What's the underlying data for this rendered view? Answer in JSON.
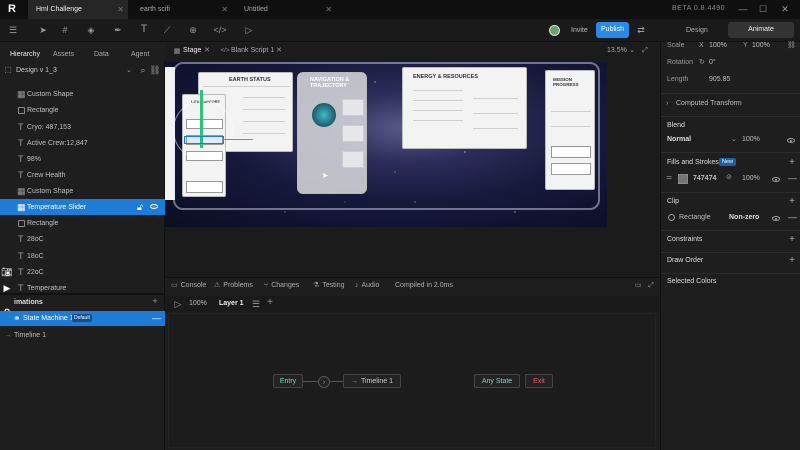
{
  "titlebar": {
    "tabs": [
      {
        "label": "Hml Challenge"
      },
      {
        "label": "earth scifi"
      },
      {
        "label": "Untitled"
      }
    ],
    "version": "BETA 0.8.4490"
  },
  "toolbar": {
    "invite": "Invite",
    "publish": "Publish",
    "design_tab": "Design",
    "animate_tab": "Animate"
  },
  "doc_tabs": {
    "stage": "Stage",
    "script": "Blank Script 1",
    "zoom": "13.5%"
  },
  "left_tabs": {
    "hierarchy": "Hierarchy",
    "assets": "Assets",
    "data": "Data",
    "agent": "Agent",
    "design_select": "Design v 1_3"
  },
  "hierarchy": [
    {
      "label": "Custom Shape",
      "kind": "group"
    },
    {
      "label": "Rectangle",
      "kind": "rect"
    },
    {
      "label": "Cryo: 487,153",
      "kind": "text"
    },
    {
      "label": "Active Crew:12,847",
      "kind": "text"
    },
    {
      "label": "98%",
      "kind": "text"
    },
    {
      "label": "Crew Health",
      "kind": "text"
    },
    {
      "label": "Custom Shape",
      "kind": "group"
    },
    {
      "label": "Temperature Slider",
      "kind": "group"
    },
    {
      "label": "Rectangle",
      "kind": "rect"
    },
    {
      "label": "28oC",
      "kind": "text"
    },
    {
      "label": "18oC",
      "kind": "text"
    },
    {
      "label": "22oC",
      "kind": "text"
    },
    {
      "label": "Temperature",
      "kind": "text"
    }
  ],
  "animations": {
    "title": "imations",
    "state_machine": "State Machine 1",
    "default_badge": "Default",
    "timeline": "Timeline 1"
  },
  "bottom_tabs": {
    "console": "Console",
    "problems": "Problems",
    "changes": "Changes",
    "testing": "Testing",
    "audio": "Audio",
    "compiled": "Compiled in 2.0ms"
  },
  "anim_toolbar": {
    "zoom": "100%",
    "layer": "Layer 1"
  },
  "graph": {
    "entry": "Entry",
    "timeline": "Timeline 1",
    "any_state": "Any State",
    "exit": "Exit"
  },
  "canvas_cards": {
    "earth_status": "EARTH STATUS",
    "navigation": "NAVIGATION & TRAJECTORY",
    "energy": "ENERGY & RESOURCES",
    "mission": "MISSION PROGRESS",
    "life_support": "LIFE SUPPORT"
  },
  "right": {
    "scale_label": "Scale",
    "scale_x": "100%",
    "scale_y": "100%",
    "rotation_label": "Rotation",
    "rotation_val": "0°",
    "length_label": "Length",
    "length_val": "905.85",
    "computed": "Computed Transform",
    "blend_title": "Blend",
    "blend_mode": "Normal",
    "blend_opacity": "100%",
    "fills_title": "Fills and Strokes",
    "new_badge": "New",
    "fill_color": "747474",
    "fill_opacity": "100%",
    "clip_title": "Clip",
    "clip_item": "Rectangle",
    "clip_mode": "Non-zero",
    "constraints": "Constraints",
    "draw_order": "Draw Order",
    "selected_colors": "Selected Colors"
  },
  "colors": {
    "accent": "#1f7cd6",
    "publish": "#2a8ae8",
    "exit": "#e0576b",
    "entry": "#7fd1c0",
    "fill": "#747474",
    "new_badge": "#1f5fa8"
  }
}
